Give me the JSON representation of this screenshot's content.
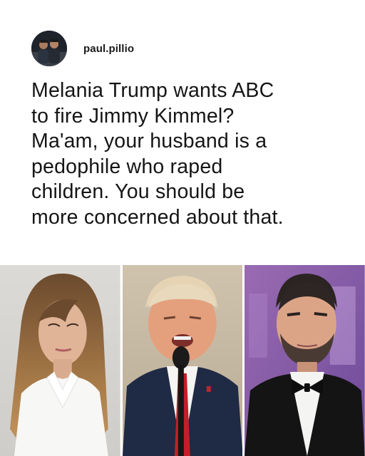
{
  "post": {
    "username": "paul.pillio",
    "lines": [
      "Melania Trump wants ABC",
      "to fire Jimmy Kimmel?",
      "Ma'am, your husband is a",
      "pedophile who raped",
      "children. You should be",
      "more concerned about that."
    ]
  },
  "colors": {
    "text": "#151515",
    "background": "#ffffff",
    "tie_red": "#c41e2a"
  }
}
